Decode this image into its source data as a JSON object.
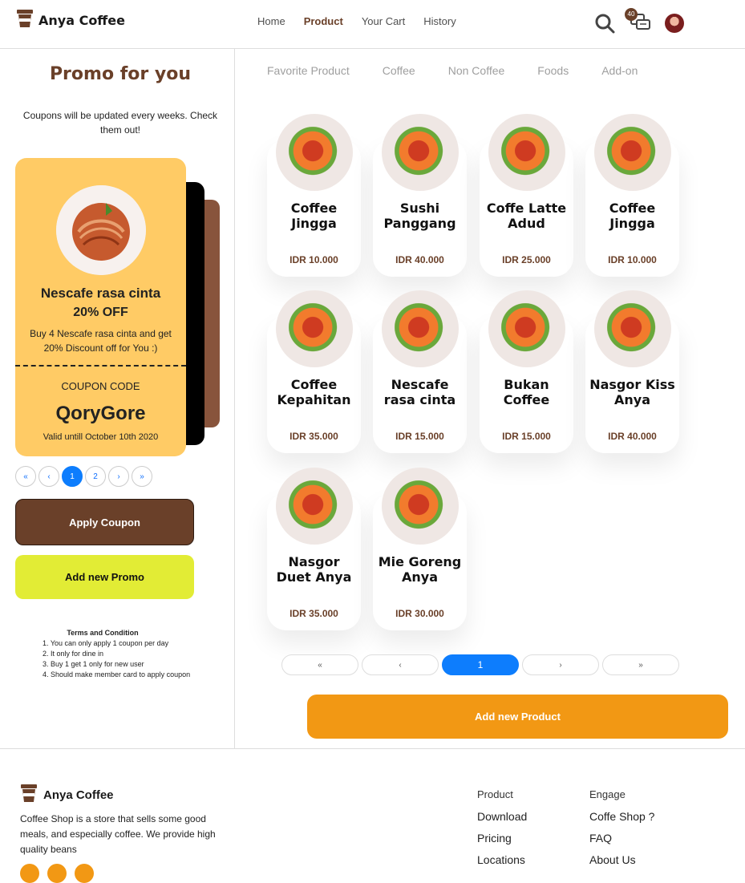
{
  "brand": {
    "name": "Anya Coffee"
  },
  "nav": {
    "links": [
      {
        "label": "Home",
        "active": false
      },
      {
        "label": "Product",
        "active": true
      },
      {
        "label": "Your Cart",
        "active": false
      },
      {
        "label": "History",
        "active": false
      }
    ],
    "chat_badge": "40",
    "icons": [
      "search-icon",
      "chat-icon",
      "avatar"
    ]
  },
  "promo": {
    "title": "Promo for you",
    "subtitle": "Coupons will be updated every weeks. Check them out!",
    "coupon": {
      "name": "Nescafe rasa cinta",
      "discount": "20% OFF",
      "description": "Buy 4 Nescafe rasa cinta and get 20% Discount off for You :)",
      "code_label": "COUPON CODE",
      "code": "QoryGore",
      "valid": "Valid untill October 10th 2020"
    },
    "pagination": [
      "«",
      "‹",
      "1",
      "2",
      "›",
      "»"
    ],
    "pagination_active": "1",
    "apply_label": "Apply Coupon",
    "add_promo_label": "Add new Promo",
    "terms": {
      "title": "Terms and Condition",
      "items": [
        "1. You can only apply 1 coupon per day",
        "2. It only for dine in",
        "3. Buy 1 get 1 only for new user",
        "4. Should make member card to apply coupon"
      ]
    }
  },
  "categories": [
    "Favorite Product",
    "Coffee",
    "Non Coffee",
    "Foods",
    "Add-on"
  ],
  "products": [
    {
      "name": "Coffee Jingga",
      "price": "IDR 10.000"
    },
    {
      "name": "Sushi Panggang",
      "price": "IDR 40.000"
    },
    {
      "name": "Coffe Latte Adud",
      "price": "IDR 25.000"
    },
    {
      "name": "Coffee Jingga",
      "price": "IDR 10.000"
    },
    {
      "name": "Coffee Kepahitan",
      "price": "IDR 35.000"
    },
    {
      "name": "Nescafe rasa cinta",
      "price": "IDR 15.000"
    },
    {
      "name": "Bukan Coffee",
      "price": "IDR 15.000"
    },
    {
      "name": "Nasgor Kiss Anya",
      "price": "IDR 40.000"
    },
    {
      "name": "Nasgor Duet Anya",
      "price": "IDR 35.000"
    },
    {
      "name": "Mie Goreng Anya",
      "price": "IDR 30.000"
    }
  ],
  "product_pagination": [
    "«",
    "‹",
    "1",
    "›",
    "»"
  ],
  "product_pagination_active": "1",
  "add_product_label": "Add new Product",
  "footer": {
    "brand": "Anya Coffee",
    "description": "Coffee Shop is a store that sells some good meals, and especially coffee. We provide high quality beans",
    "col1": {
      "head": "Product",
      "items": [
        "Download",
        "Pricing",
        "Locations"
      ]
    },
    "col2": {
      "head": "Engage",
      "items": [
        "Coffe Shop ?",
        "FAQ",
        "About Us"
      ]
    }
  },
  "colors": {
    "brown": "#6a4029",
    "yellow": "#ffcb65",
    "orange": "#f29814",
    "lime": "#e2ec35",
    "blue": "#0d7dfd"
  }
}
